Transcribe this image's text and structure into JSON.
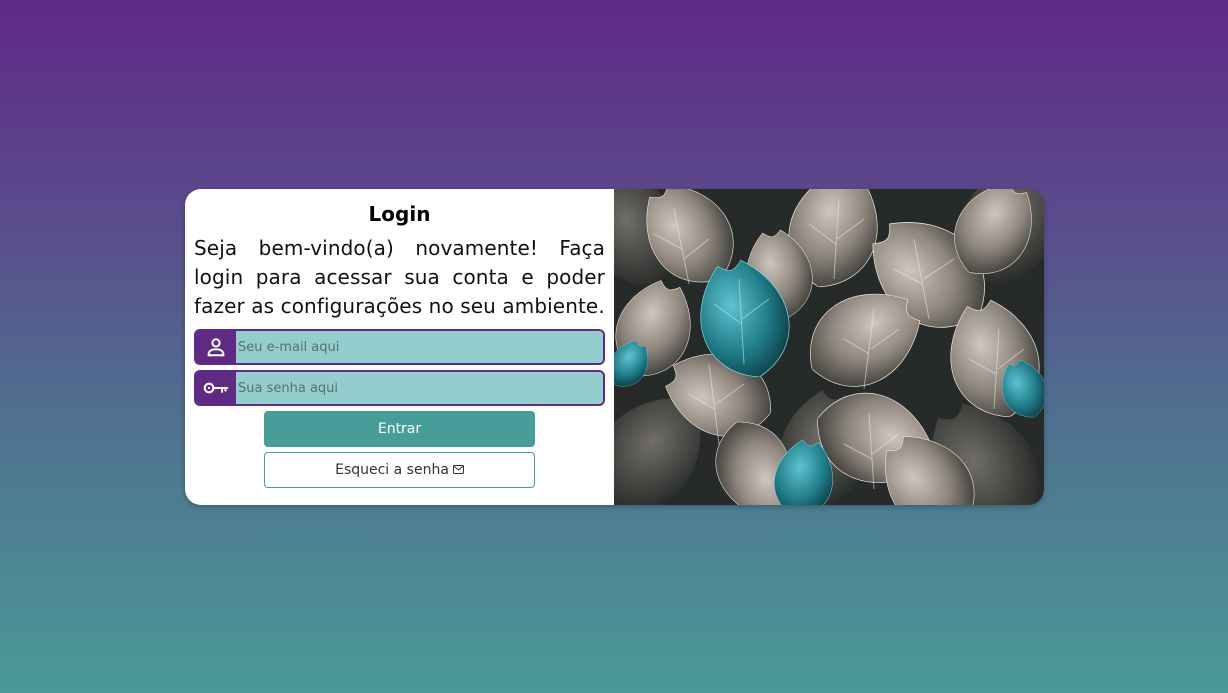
{
  "login": {
    "title": "Login",
    "welcome_text": "Seja bem-vindo(a) novamente! Faça login para acessar sua conta e poder fazer as configurações no seu ambiente.",
    "email": {
      "placeholder": "Seu e-mail aqui",
      "value": "",
      "icon": "user-icon"
    },
    "password": {
      "placeholder": "Sua senha aqui",
      "value": "",
      "icon": "key-icon"
    },
    "submit_label": "Entrar",
    "forgot_label": "Esqueci a senha",
    "forgot_icon": "envelope-icon"
  },
  "image": {
    "subject": "dark foliage with teal and grey leaves",
    "icon": "leaves-image"
  },
  "colors": {
    "accent_purple": "#5e2a84",
    "input_fill": "#93cdcd",
    "button_teal": "#479e98",
    "background_top": "#5f2a86",
    "background_bottom": "#4a9a98"
  }
}
